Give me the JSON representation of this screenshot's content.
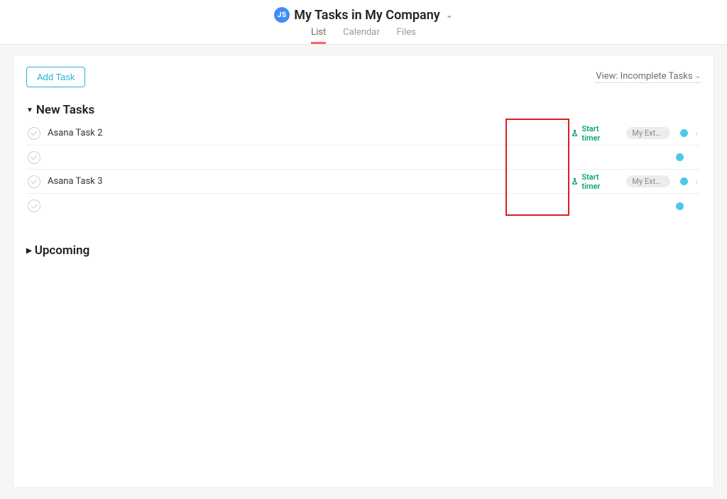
{
  "header": {
    "avatar_initials": "JS",
    "title": "My Tasks in My Company",
    "tabs": [
      {
        "label": "List",
        "active": true
      },
      {
        "label": "Calendar",
        "active": false
      },
      {
        "label": "Files",
        "active": false
      }
    ]
  },
  "toolbar": {
    "add_task_label": "Add Task",
    "view_label": "View: Incomplete Tasks"
  },
  "sections": [
    {
      "name": "New Tasks",
      "expanded": true,
      "tasks": [
        {
          "title": "Asana Task 2",
          "start_timer_label": "Start timer",
          "project": "My Extern...",
          "has_timer": true,
          "has_project": true,
          "has_arrow": true
        },
        {
          "title": "",
          "has_timer": false,
          "has_project": false,
          "has_arrow": false
        },
        {
          "title": "Asana Task 3",
          "start_timer_label": "Start timer",
          "project": "My Extern...",
          "has_timer": true,
          "has_project": true,
          "has_arrow": true
        },
        {
          "title": "",
          "has_timer": false,
          "has_project": false,
          "has_arrow": false
        }
      ]
    },
    {
      "name": "Upcoming",
      "expanded": false,
      "tasks": []
    }
  ]
}
